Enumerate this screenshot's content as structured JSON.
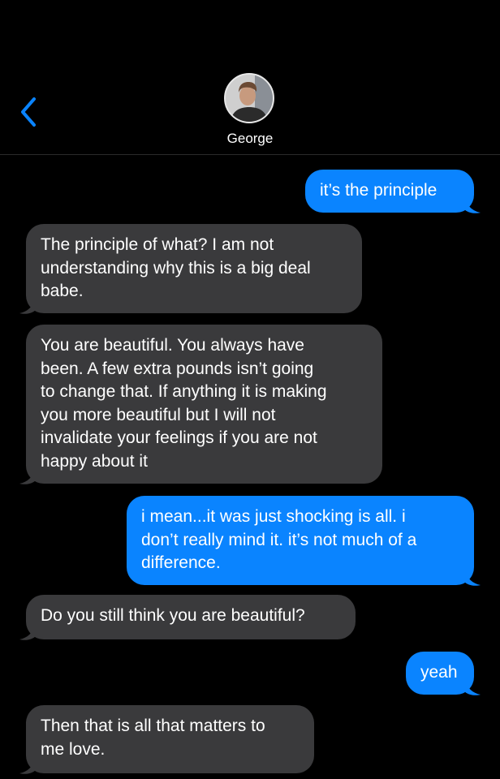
{
  "header": {
    "contact_name": "George"
  },
  "colors": {
    "background": "#000000",
    "incoming_bubble": "#3a3a3c",
    "outgoing_bubble": "#0a84ff",
    "accent": "#0a84ff"
  },
  "messages": [
    {
      "direction": "outgoing",
      "text": "it’s the principle"
    },
    {
      "direction": "incoming",
      "text": "The principle of what? I am not\nunderstanding why this is a big deal\nbabe."
    },
    {
      "direction": "incoming",
      "text": "You are beautiful. You always have\nbeen. A few extra pounds isn’t going\nto change that. If anything it is making\nyou more beautiful but I will not\ninvalidate your feelings if you are not\nhappy about it"
    },
    {
      "direction": "outgoing",
      "text": "i mean...it was just shocking is all. i\ndon’t really mind it. it’s not much of a\ndifference."
    },
    {
      "direction": "incoming",
      "text": "Do you still think you are beautiful?"
    },
    {
      "direction": "outgoing",
      "text": "yeah"
    },
    {
      "direction": "incoming",
      "text": "Then that is all that matters to\nme love."
    }
  ]
}
